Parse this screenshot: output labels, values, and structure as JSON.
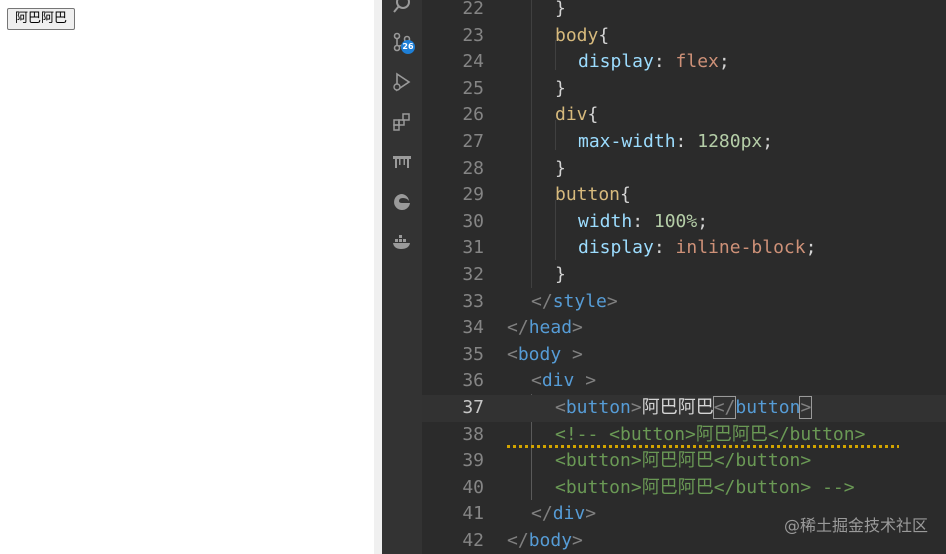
{
  "preview": {
    "button_label": "阿巴阿巴"
  },
  "activity_bar": {
    "icons": [
      "search-icon",
      "source-control-icon",
      "run-debug-icon",
      "extensions-icon",
      "bridge-icon",
      "edge-icon",
      "docker-icon"
    ],
    "badge": "26"
  },
  "editor": {
    "lines": [
      {
        "n": "22",
        "t": "}"
      },
      {
        "n": "23",
        "t": "body{"
      },
      {
        "n": "24",
        "t": "display: flex;"
      },
      {
        "n": "25",
        "t": "}"
      },
      {
        "n": "26",
        "t": "div{"
      },
      {
        "n": "27",
        "t": "max-width: 1280px;"
      },
      {
        "n": "28",
        "t": "}"
      },
      {
        "n": "29",
        "t": "button{"
      },
      {
        "n": "30",
        "t": "width: 100%;"
      },
      {
        "n": "31",
        "t": "display: inline-block;"
      },
      {
        "n": "32",
        "t": "}"
      },
      {
        "n": "33",
        "t": "</style>"
      },
      {
        "n": "34",
        "t": "</head>"
      },
      {
        "n": "35",
        "t": "<body >"
      },
      {
        "n": "36",
        "t": "<div >"
      },
      {
        "n": "37",
        "t": "<button>阿巴阿巴</button>"
      },
      {
        "n": "38",
        "t": "<!-- <button>阿巴阿巴</button>"
      },
      {
        "n": "39",
        "t": "<button>阿巴阿巴</button>"
      },
      {
        "n": "40",
        "t": "<button>阿巴阿巴</button> -->"
      },
      {
        "n": "41",
        "t": "</div>"
      },
      {
        "n": "42",
        "t": "</body>"
      }
    ],
    "tokens": {
      "brace_open": "{",
      "brace_close": "}",
      "colon": ":",
      "semi": ";",
      "body": "body",
      "div": "div",
      "button": "button",
      "style": "style",
      "head": "head",
      "display": "display",
      "flex": "flex",
      "max_width": "max-width",
      "v1280": "1280px",
      "width": "width",
      "v100": "100%",
      "inline_block": "inline-block",
      "lt": "<",
      "gt": ">",
      "lt_slash": "</",
      "sp": " ",
      "btn_text": "阿巴阿巴",
      "c38": "<!-- <button>阿巴阿巴</button>",
      "c39": "<button>阿巴阿巴</button>",
      "c40": "<button>阿巴阿巴</button> -->"
    }
  },
  "watermark": "@稀土掘金技术社区",
  "colors": {
    "editor_bg": "#2b2b2b",
    "activity_bg": "#333333",
    "badge": "#1e7fd6",
    "tag": "#569cd6",
    "selector": "#d7ba7d",
    "property": "#9cdcfe",
    "value": "#ce9178",
    "number": "#b5cea8",
    "comment": "#6a9955"
  }
}
